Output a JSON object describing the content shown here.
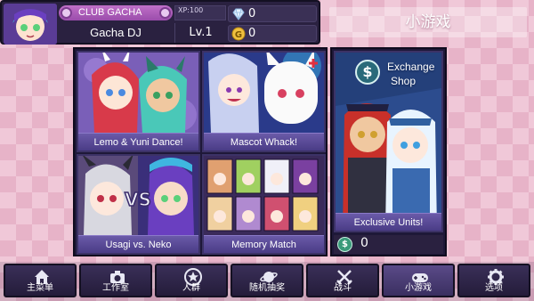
{
  "profile": {
    "club": "CLUB GACHA",
    "xp_label": "XP:100",
    "name": "Gacha DJ",
    "level": "Lv.1",
    "diamonds": "0",
    "gold": "0",
    "gold_symbol": "G"
  },
  "title": "小游戏",
  "games": [
    {
      "label": "Lemo & Yuni Dance!"
    },
    {
      "label": "Mascot Whack!"
    },
    {
      "label": "Usagi vs. Neko",
      "vs": "VS"
    },
    {
      "label": "Memory Match"
    }
  ],
  "shop": {
    "title_line1": "Exchange",
    "title_line2": "Shop",
    "banner": "Exclusive Units!",
    "currency_symbol": "$",
    "balance": "0"
  },
  "nav": [
    {
      "label": "主菜单",
      "icon": "home-icon"
    },
    {
      "label": "工作室",
      "icon": "camera-icon"
    },
    {
      "label": "人群",
      "icon": "star-icon"
    },
    {
      "label": "随机抽奖",
      "icon": "planet-icon"
    },
    {
      "label": "战斗",
      "icon": "crossed-swords-icon"
    },
    {
      "label": "小游戏",
      "icon": "gamepad-icon"
    },
    {
      "label": "选项",
      "icon": "gear-icon"
    }
  ],
  "colors": {
    "panel": "#2a2140",
    "accent": "#c070c8",
    "label_bar": "#5a4a98",
    "background": "#f0c8d8"
  }
}
